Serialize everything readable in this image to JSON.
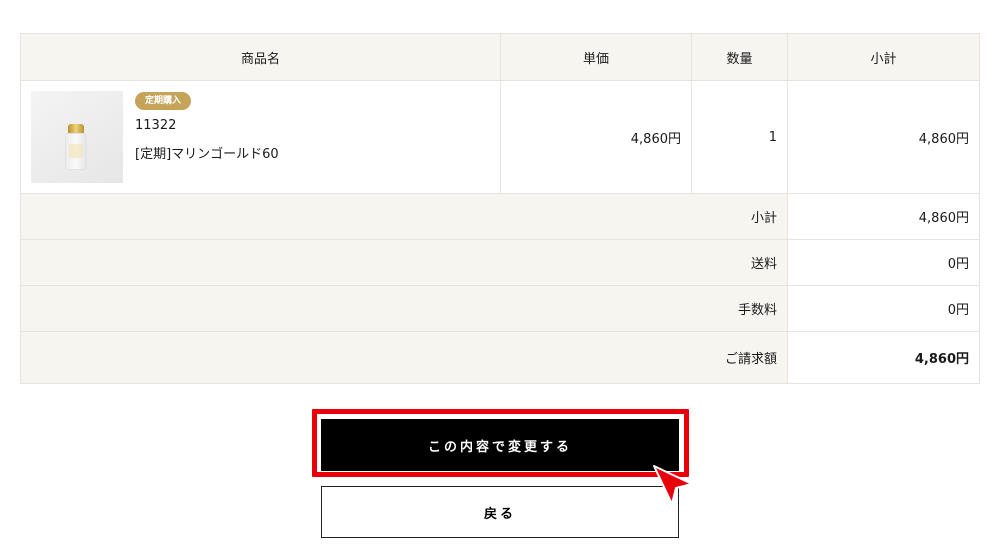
{
  "table": {
    "headers": {
      "product": "商品名",
      "unit_price": "単価",
      "quantity": "数量",
      "subtotal": "小計"
    },
    "item": {
      "badge": "定期購入",
      "code": "11322",
      "name": "[定期]マリンゴールド60",
      "unit_price": "4,860円",
      "quantity": "1",
      "subtotal": "4,860円"
    },
    "summary": [
      {
        "label": "小計",
        "value": "4,860円"
      },
      {
        "label": "送料",
        "value": "0円"
      },
      {
        "label": "手数料",
        "value": "0円"
      },
      {
        "label": "ご請求額",
        "value": "4,860円"
      }
    ]
  },
  "buttons": {
    "confirm": "この内容で変更する",
    "back": "戻る"
  },
  "colors": {
    "accent_badge": "#c5a45a",
    "highlight": "#e8000b",
    "header_bg": "#f7f5f0"
  }
}
